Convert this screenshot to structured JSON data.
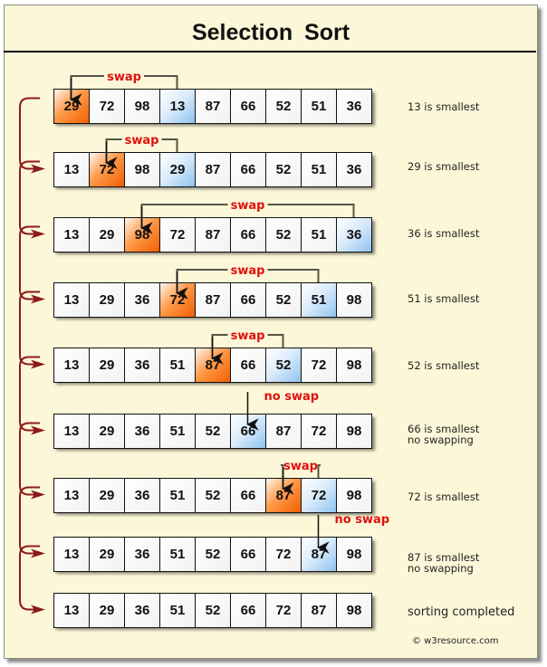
{
  "title": "Selection  Sort",
  "colors": {
    "background": "#fcf7d8",
    "current_position": "#f25f00",
    "smallest": "#8fc3f0",
    "swap_label": "#e01010",
    "connector": "#8b1a1a",
    "bracket": "#555545"
  },
  "passes": [
    {
      "values": [
        29,
        72,
        98,
        13,
        87,
        66,
        52,
        51,
        36
      ],
      "current": 0,
      "smallest": 3,
      "label": "swap",
      "note": "13 is smallest"
    },
    {
      "values": [
        13,
        72,
        98,
        29,
        87,
        66,
        52,
        51,
        36
      ],
      "current": 1,
      "smallest": 3,
      "label": "swap",
      "note": "29 is smallest"
    },
    {
      "values": [
        13,
        29,
        98,
        72,
        87,
        66,
        52,
        51,
        36
      ],
      "current": 2,
      "smallest": 8,
      "label": "swap",
      "note": "36 is smallest"
    },
    {
      "values": [
        13,
        29,
        36,
        72,
        87,
        66,
        52,
        51,
        98
      ],
      "current": 3,
      "smallest": 7,
      "label": "swap",
      "note": "51 is smallest"
    },
    {
      "values": [
        13,
        29,
        36,
        51,
        87,
        66,
        52,
        72,
        98
      ],
      "current": 4,
      "smallest": 6,
      "label": "swap",
      "note": "52 is smallest"
    },
    {
      "values": [
        13,
        29,
        36,
        51,
        52,
        66,
        87,
        72,
        98
      ],
      "current": 5,
      "smallest": 5,
      "label": "no swap",
      "note": "66 is smallest\nno swapping"
    },
    {
      "values": [
        13,
        29,
        36,
        51,
        52,
        66,
        87,
        72,
        98
      ],
      "current": 6,
      "smallest": 7,
      "label": "swap",
      "note": "72 is smallest"
    },
    {
      "values": [
        13,
        29,
        36,
        51,
        52,
        66,
        72,
        87,
        98
      ],
      "current": 7,
      "smallest": 7,
      "label": "no swap",
      "note": "87 is smallest\nno swapping"
    },
    {
      "values": [
        13,
        29,
        36,
        51,
        52,
        66,
        72,
        87,
        98
      ],
      "current": null,
      "smallest": null,
      "label": null,
      "note": "sorting completed"
    }
  ],
  "credit": "© w3resource.com"
}
